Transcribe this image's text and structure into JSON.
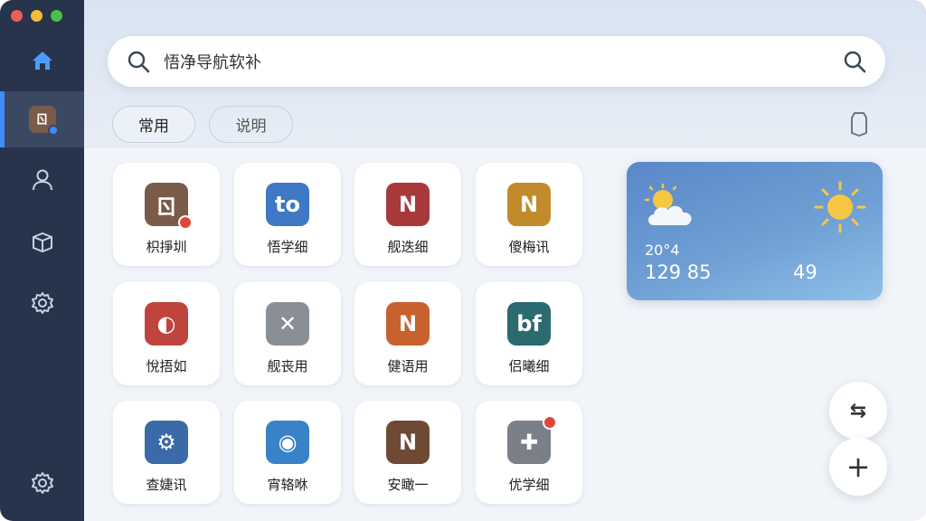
{
  "window": {
    "controls": [
      "close",
      "minimize",
      "maximize"
    ]
  },
  "sidebar": {
    "items": [
      {
        "name": "home",
        "icon": "home-icon"
      },
      {
        "name": "apps",
        "icon": "app-icon",
        "label": "ㄖ"
      },
      {
        "name": "user",
        "icon": "user-icon"
      },
      {
        "name": "box",
        "icon": "box-icon"
      },
      {
        "name": "settings",
        "icon": "gear-icon"
      }
    ],
    "bottom_item": {
      "name": "settings-bottom",
      "icon": "gear-icon"
    },
    "active_index": 1,
    "accent": "#3f8cff"
  },
  "search": {
    "query": "悟净导航软补"
  },
  "tabs": [
    {
      "label": "常用",
      "active": true
    },
    {
      "label": "说明",
      "active": false
    }
  ],
  "apps": [
    {
      "label": "枳掙圳",
      "icon_text": "ㄖ",
      "color": "#7a5a49",
      "badge": true
    },
    {
      "label": "悟学细",
      "icon_text": "to",
      "color": "#3f78c4"
    },
    {
      "label": "舰迭细",
      "icon_text": "N",
      "color": "#a8393a"
    },
    {
      "label": "傻梅讯",
      "icon_text": "N",
      "color": "#c18b2c"
    },
    {
      "label": "悅捂如",
      "icon_text": "◐",
      "color": "#c0443e"
    },
    {
      "label": "舰丧用",
      "icon_text": "✕",
      "color": "#8a8f97"
    },
    {
      "label": "健语用",
      "icon_text": "N",
      "color": "#c7622e"
    },
    {
      "label": "侣曦细",
      "icon_text": "bf",
      "color": "#2b6a6e"
    },
    {
      "label": "查婕讯",
      "icon_text": "⚙",
      "color": "#3a6aa8"
    },
    {
      "label": "宵辂咻",
      "icon_text": "◉",
      "color": "#3a82c8"
    },
    {
      "label": "安瞰一",
      "icon_text": "N",
      "color": "#6e4a35"
    },
    {
      "label": "优学细",
      "icon_text": "✚",
      "color": "#7b8088",
      "badge_top": true
    }
  ],
  "weather": {
    "temp": "20°4",
    "values_left": "129 85",
    "value_right": "49",
    "left_icon": "cloud-sun-icon",
    "right_icon": "sun-icon"
  },
  "fabs": [
    {
      "name": "share",
      "label": "⇆"
    },
    {
      "name": "add",
      "label": "+"
    }
  ]
}
